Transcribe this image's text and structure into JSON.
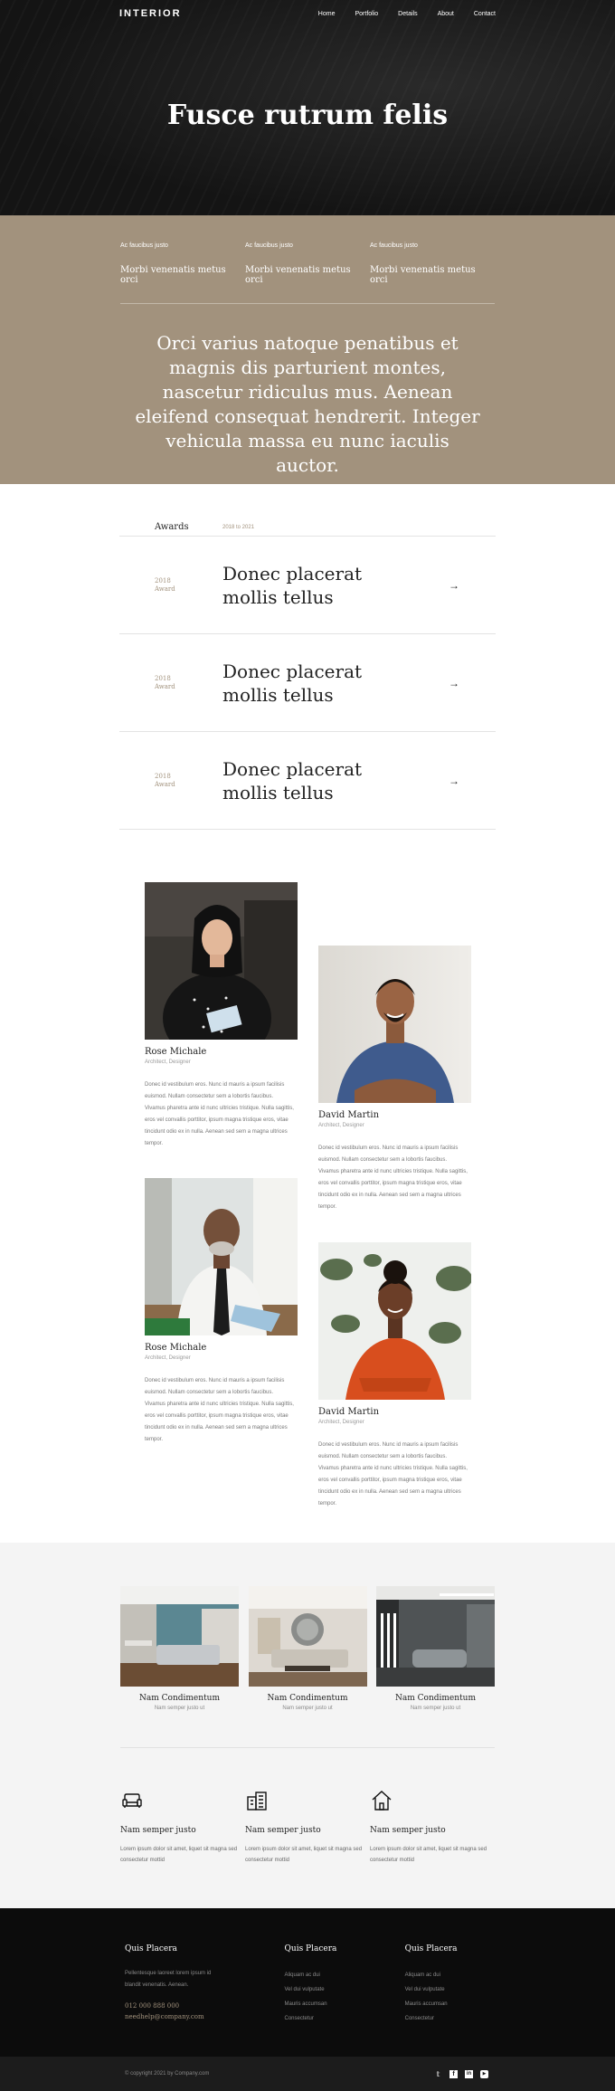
{
  "nav": {
    "logo": "INTERIOR",
    "items": [
      "Home",
      "Portfolio",
      "Details",
      "About",
      "Contact"
    ]
  },
  "hero": {
    "title": "Fusce rutrum felis"
  },
  "info": {
    "columns": [
      {
        "label": "Ac faucibus justo",
        "value": "Morbi venenatis metus orci"
      },
      {
        "label": "Ac faucibus justo",
        "value": "Morbi venenatis metus orci"
      },
      {
        "label": "Ac faucibus justo",
        "value": "Morbi venenatis metus orci"
      }
    ],
    "quote": "Orci varius natoque penatibus et magnis dis parturient montes, nascetur ridiculus mus. Aenean eleifend consequat hendrerit. Integer vehicula massa eu nunc iaculis auctor."
  },
  "awards": {
    "title": "Awards",
    "range": "2018 to 2021",
    "rows": [
      {
        "year": "2018",
        "type": "Award",
        "title": "Donec placerat mollis tellus"
      },
      {
        "year": "2018",
        "type": "Award",
        "title": "Donec placerat mollis tellus"
      },
      {
        "year": "2018",
        "type": "Award",
        "title": "Donec placerat mollis tellus"
      }
    ]
  },
  "team": {
    "members": [
      {
        "name": "Rose Michale",
        "role": "Architect, Designer",
        "bio": "Donec id vestibulum eros. Nunc id mauris a ipsum facilisis euismod. Nullam consectetur sem a lobortis faucibus. Vivamus pharetra ante id nunc ultricies tristique. Nulla sagittis, eros vel convallis porttitor, ipsum magna tristique eros, vitae tincidunt odio ex in nulla. Aenean sed sem a magna ultrices tempor."
      },
      {
        "name": "David Martin",
        "role": "Architect, Designer",
        "bio": "Donec id vestibulum eros. Nunc id mauris a ipsum facilisis euismod. Nullam consectetur sem a lobortis faucibus. Vivamus pharetra ante id nunc ultricies tristique. Nulla sagittis, eros vel convallis porttitor, ipsum magna tristique eros, vitae tincidunt odio ex in nulla. Aenean sed sem a magna ultrices tempor."
      },
      {
        "name": "Rose Michale",
        "role": "Architect, Designer",
        "bio": "Donec id vestibulum eros. Nunc id mauris a ipsum facilisis euismod. Nullam consectetur sem a lobortis faucibus. Vivamus pharetra ante id nunc ultricies tristique. Nulla sagittis, eros vel convallis porttitor, ipsum magna tristique eros, vitae tincidunt odio ex in nulla. Aenean sed sem a magna ultrices tempor."
      },
      {
        "name": "David Martin",
        "role": "Architect, Designer",
        "bio": "Donec id vestibulum eros. Nunc id mauris a ipsum facilisis euismod. Nullam consectetur sem a lobortis faucibus. Vivamus pharetra ante id nunc ultricies tristique. Nulla sagittis, eros vel convallis porttitor, ipsum magna tristique eros, vitae tincidunt odio ex in nulla. Aenean sed sem a magna ultrices tempor."
      }
    ]
  },
  "gallery": {
    "items": [
      {
        "title": "Nam Condimentum",
        "sub": "Nam semper justo ut"
      },
      {
        "title": "Nam Condimentum",
        "sub": "Nam semper justo ut"
      },
      {
        "title": "Nam Condimentum",
        "sub": "Nam semper justo ut"
      }
    ]
  },
  "features": [
    {
      "icon": "sofa-icon",
      "title": "Nam semper justo",
      "desc": "Lorem ipsum dolor sit amet, liquet sit magna sed consectetur mottid"
    },
    {
      "icon": "building-icon",
      "title": "Nam semper justo",
      "desc": "Lorem ipsum dolor sit amet, liquet sit magna sed consectetur mottid"
    },
    {
      "icon": "house-icon",
      "title": "Nam semper justo",
      "desc": "Lorem ipsum dolor sit amet, liquet sit magna sed consectetur mottid"
    }
  ],
  "footer": {
    "col1": {
      "title": "Quis Placera",
      "text": "Pellentesque laoreet lorem ipsum id blandit venenatis. Aenean.",
      "phone": "012 000 888 000",
      "email": "needhelp@company.com"
    },
    "col2": {
      "title": "Quis Placera",
      "links": [
        "Aliquam ac dui",
        "Vel dui vulputate",
        "Mauris accumsan",
        "Consectetur"
      ]
    },
    "col3": {
      "title": "Quis Placera",
      "links": [
        "Aliquam ac dui",
        "Vel dui vulputate",
        "Mauris accumsan",
        "Consectetur"
      ]
    },
    "copyright": "© copyright 2021 by Company.com",
    "social": [
      "twitter-icon",
      "facebook-icon",
      "linkedin-icon",
      "youtube-icon"
    ]
  },
  "colors": {
    "accent": "#a2927d",
    "dark": "#1a1a1a",
    "footer": "#0c0c0c"
  }
}
